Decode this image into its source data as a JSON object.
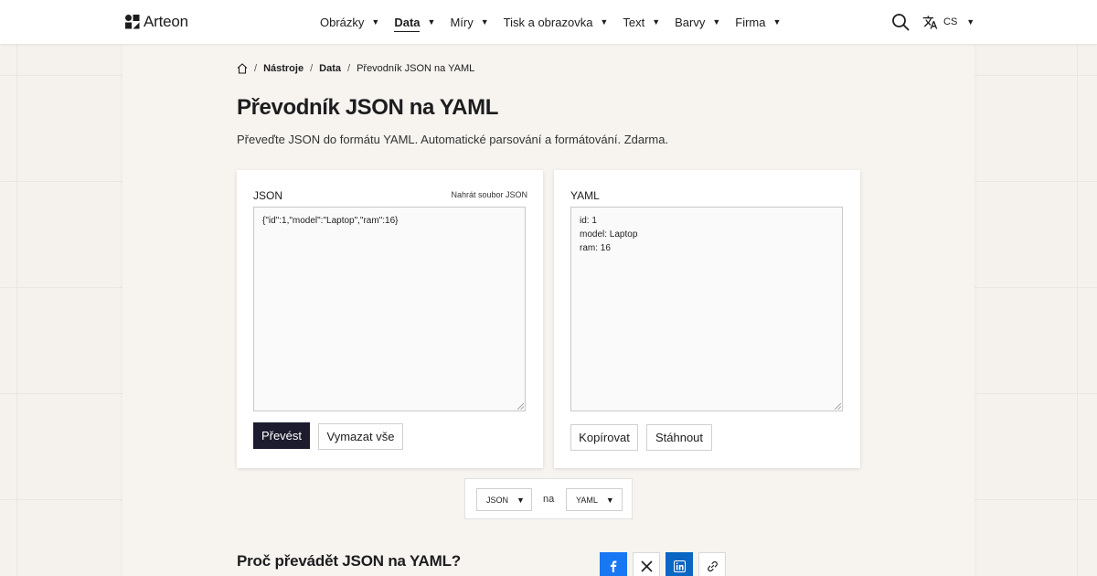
{
  "header": {
    "brand": "Arteon",
    "nav": [
      {
        "label": "Obrázky",
        "active": false
      },
      {
        "label": "Data",
        "active": true
      },
      {
        "label": "Míry",
        "active": false
      },
      {
        "label": "Tisk a obrazovka",
        "active": false
      },
      {
        "label": "Text",
        "active": false
      },
      {
        "label": "Barvy",
        "active": false
      },
      {
        "label": "Firma",
        "active": false
      }
    ],
    "language": "CS"
  },
  "breadcrumb": {
    "items": [
      "Nástroje",
      "Data",
      "Převodník JSON na YAML"
    ]
  },
  "page": {
    "title": "Převodník JSON na YAML",
    "description": "Převeďte JSON do formátu YAML. Automatické parsování a formátování. Zdarma."
  },
  "input_panel": {
    "label": "JSON",
    "upload_link": "Nahrát soubor JSON",
    "value": "{\"id\":1,\"model\":\"Laptop\",\"ram\":16}",
    "convert_button": "Převést",
    "clear_button": "Vymazat vše"
  },
  "output_panel": {
    "label": "YAML",
    "value": "id: 1\nmodel: Laptop\nram: 16",
    "copy_button": "Kopírovat",
    "download_button": "Stáhnout"
  },
  "format_bar": {
    "from": "JSON",
    "connector": "na",
    "to": "YAML"
  },
  "section": {
    "title": "Proč převádět JSON na YAML?"
  },
  "icons": {
    "search": "search-icon",
    "language": "translate-icon",
    "home": "home-icon",
    "share": [
      "facebook-icon",
      "x-icon",
      "linkedin-icon",
      "link-icon"
    ]
  },
  "colors": {
    "primary_button": "#1c1c2e",
    "facebook": "#1877f2",
    "linkedin": "#0a66c2",
    "page_background": "#f5f2ee"
  }
}
